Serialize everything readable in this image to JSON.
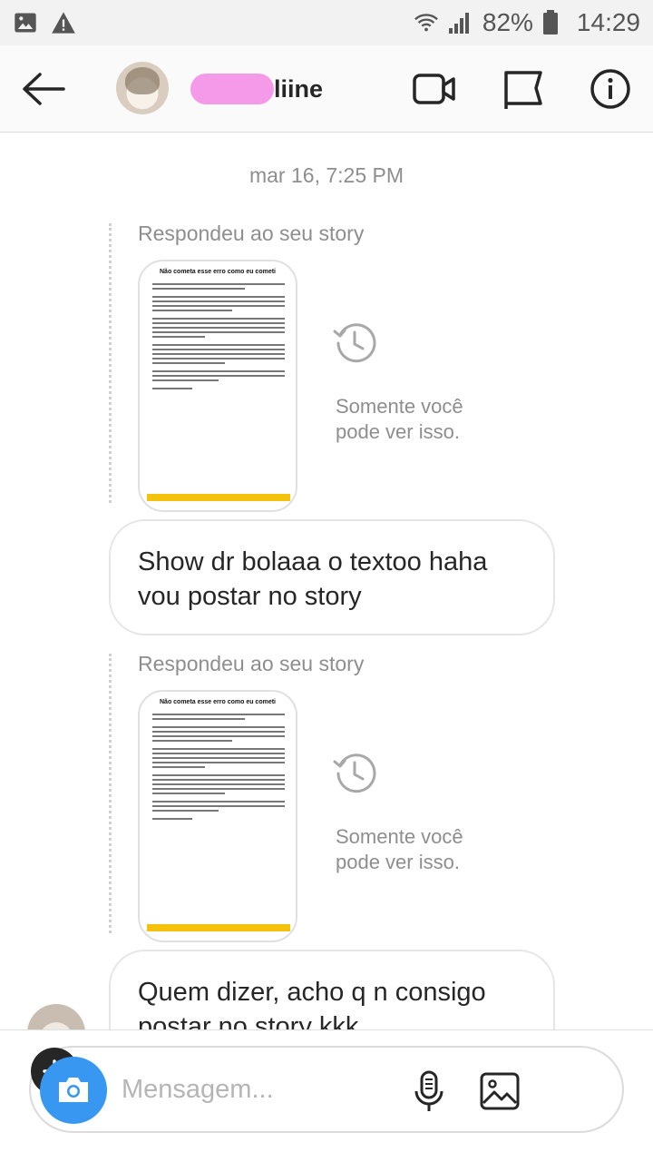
{
  "status_bar": {
    "battery": "82%",
    "time": "14:29",
    "icons": [
      "image-icon",
      "warning-icon",
      "wifi-icon",
      "signal-icon",
      "battery-icon"
    ]
  },
  "header": {
    "username": "liine",
    "icons": [
      "back-arrow-icon",
      "video-call-icon",
      "flag-icon",
      "info-icon"
    ]
  },
  "chat": {
    "timestamp": "mar 16, 7:25 PM",
    "messages": [
      {
        "type": "story_reply",
        "label": "Respondeu ao seu story",
        "story_title": "Não cometa esse erro como eu cometi",
        "note": "Somente você pode ver isso."
      },
      {
        "type": "text",
        "text": "Show dr bolaaa o textoo haha vou postar no story"
      },
      {
        "type": "story_reply",
        "label": "Respondeu ao seu story",
        "story_title": "Não cometa esse erro como eu cometi",
        "note": "Somente você pode ver isso."
      },
      {
        "type": "text",
        "text": "Quem dizer, acho q n consigo postar no story kkk"
      }
    ]
  },
  "composer": {
    "placeholder": "Mensagem...",
    "icons": [
      "camera-icon",
      "microphone-icon",
      "gallery-icon",
      "plus-icon"
    ]
  },
  "colors": {
    "accent": "#3897f0",
    "text": "#262626",
    "muted": "#8e8e8e",
    "story_bar": "#f4c20d",
    "username_redaction": "#f59ae8"
  }
}
